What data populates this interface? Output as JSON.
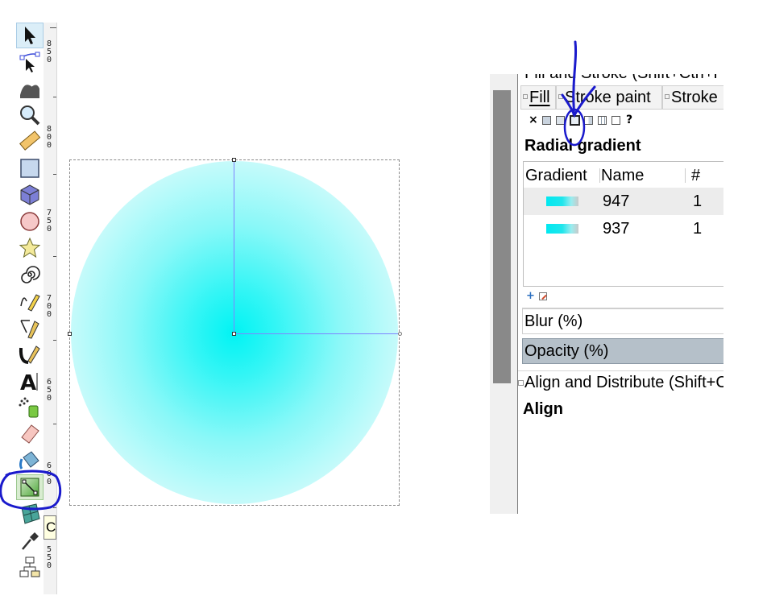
{
  "toolbox": {
    "tools": [
      {
        "name": "selector-tool-icon",
        "icon": "arrow-pointer"
      },
      {
        "name": "node-tool-icon",
        "icon": "node-edit"
      },
      {
        "name": "tweak-tool-icon",
        "icon": "wave"
      },
      {
        "name": "zoom-tool-icon",
        "icon": "magnifier"
      },
      {
        "name": "measure-tool-icon",
        "icon": "ruler"
      },
      {
        "name": "rectangle-tool-icon",
        "icon": "square"
      },
      {
        "name": "box3d-tool-icon",
        "icon": "cube"
      },
      {
        "name": "ellipse-tool-icon",
        "icon": "circle"
      },
      {
        "name": "star-tool-icon",
        "icon": "star"
      },
      {
        "name": "spiral-tool-icon",
        "icon": "spiral"
      },
      {
        "name": "pencil-tool-icon",
        "icon": "pencil"
      },
      {
        "name": "pen-tool-icon",
        "icon": "pen"
      },
      {
        "name": "calligraphy-tool-icon",
        "icon": "calligraphy"
      },
      {
        "name": "text-tool-icon",
        "icon": "text-a"
      },
      {
        "name": "spray-tool-icon",
        "icon": "spray"
      },
      {
        "name": "eraser-tool-icon",
        "icon": "eraser"
      },
      {
        "name": "paint-bucket-tool-icon",
        "icon": "bucket"
      },
      {
        "name": "gradient-tool-icon",
        "icon": "gradient"
      },
      {
        "name": "mesh-tool-icon",
        "icon": "mesh"
      },
      {
        "name": "dropper-tool-icon",
        "icon": "dropper"
      },
      {
        "name": "connector-tool-icon",
        "icon": "connector"
      }
    ]
  },
  "ruler": {
    "labels": [
      {
        "text": "8\n5\n0"
      },
      {
        "text": "8\n0\n0"
      },
      {
        "text": "7\n5\n0"
      },
      {
        "text": "7\n0\n0"
      },
      {
        "text": "6\n5\n0"
      },
      {
        "text": "6\n0\n0"
      },
      {
        "text": "5\n5\n0"
      }
    ]
  },
  "tooltip": {
    "text": "C"
  },
  "panel": {
    "dialog_title": "Fill and Stroke (Shift+Ctrl+F)",
    "tabs": {
      "fill": "Fill",
      "stroke_paint": "Stroke paint",
      "stroke_style": "Stroke"
    },
    "paint_modes": {
      "none": "×",
      "unknown": "?"
    },
    "section_title": "Radial gradient",
    "table": {
      "columns": {
        "gradient": "Gradient",
        "name": "Name",
        "count": "#"
      },
      "rows": [
        {
          "name": "947",
          "count": "1"
        },
        {
          "name": "937",
          "count": "1"
        }
      ]
    },
    "blur_label": "Blur (%)",
    "opacity_label": "Opacity (%)",
    "align_dialog_title": "Align and Distribute (Shift+Ctrl+A)",
    "align_section": "Align"
  },
  "colors": {
    "gradient_stop": "#00f3f3",
    "annotation_ink": "#1a1acc",
    "handle_line": "#7e84ff"
  }
}
